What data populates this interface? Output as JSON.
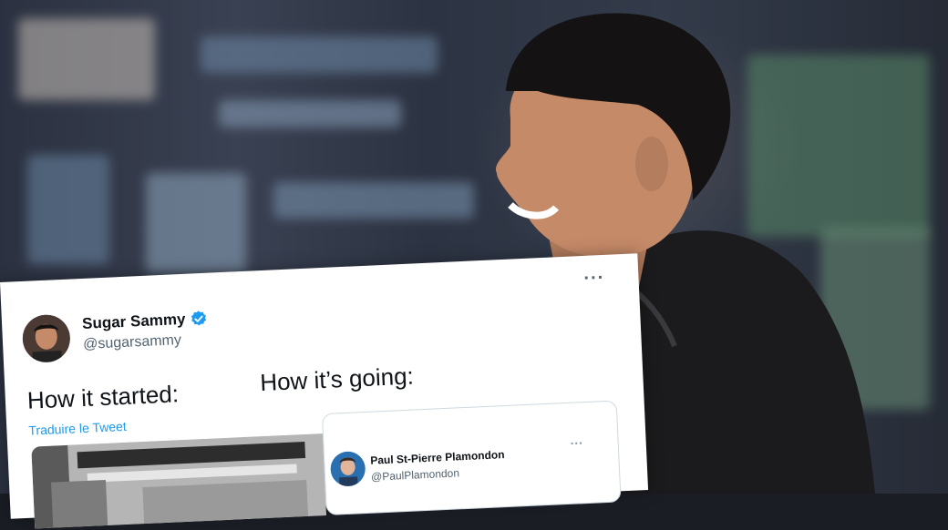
{
  "tweet": {
    "display_name": "Sugar Sammy",
    "handle": "@sugarsammy",
    "text_left": "How it started:",
    "text_right": "How it’s going:",
    "translate_label": "Traduire le Tweet",
    "more_label": "···",
    "avatar_icon": "profile-photo",
    "verified_icon": "verified-badge-icon",
    "link_color": "#1d9bf0"
  },
  "quoted_tweet": {
    "display_name": "Paul St-Pierre Plamondon",
    "handle": "@PaulPlamondon",
    "more_label": "···"
  }
}
